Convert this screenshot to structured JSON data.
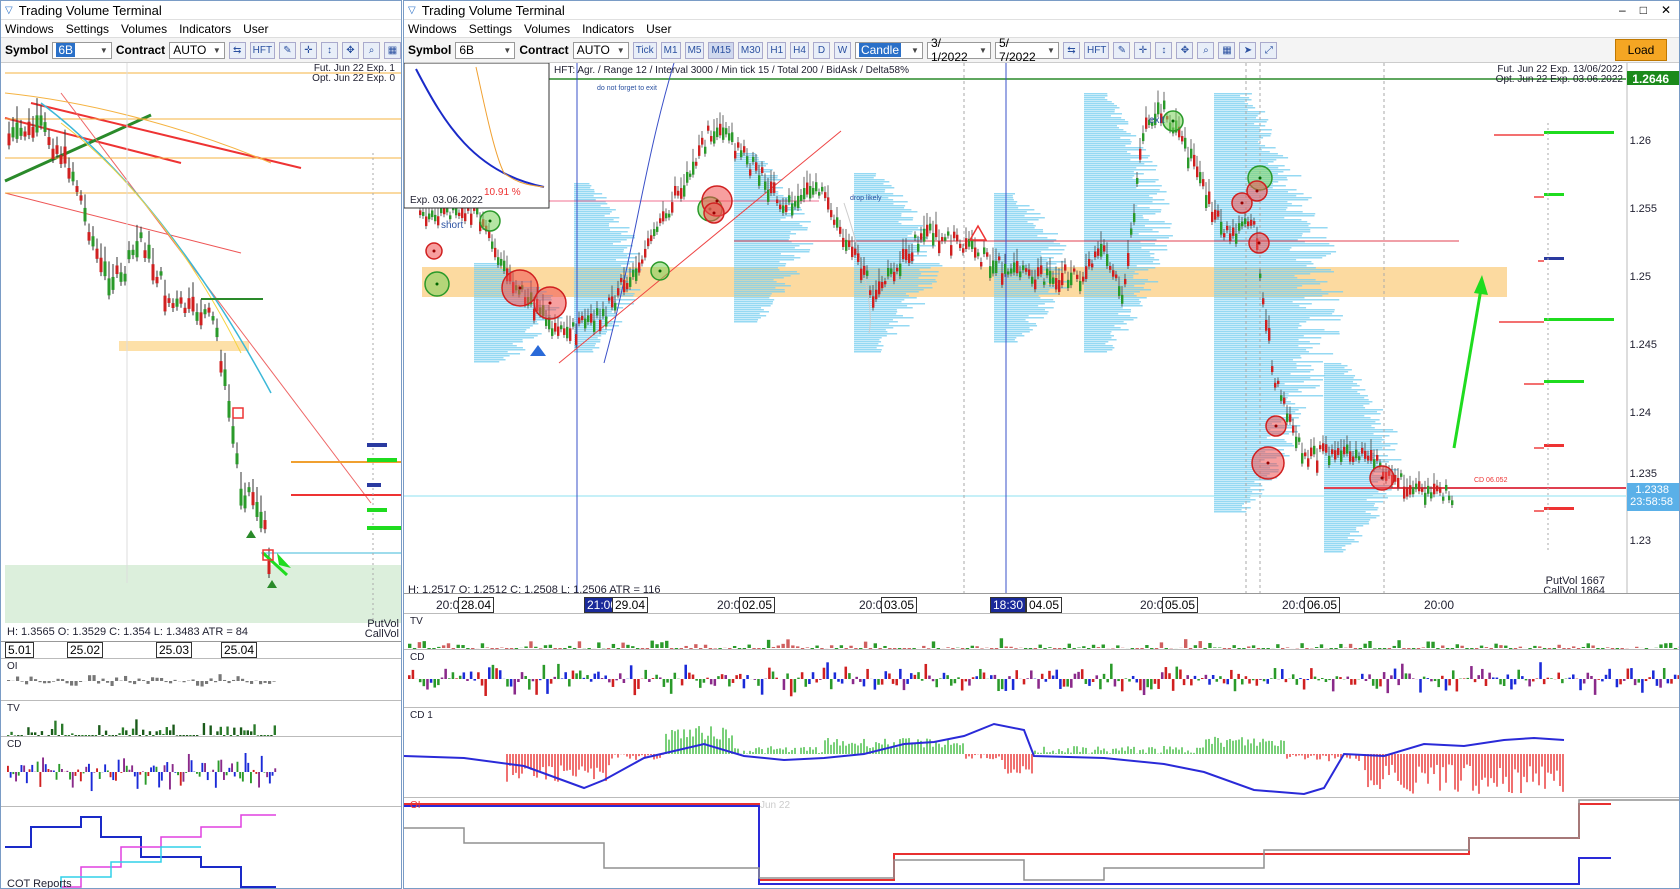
{
  "left": {
    "title": "Trading Volume Terminal",
    "menu": [
      "Windows",
      "Settings",
      "Volumes",
      "Indicators",
      "User"
    ],
    "symbol_label": "Symbol",
    "symbol": "6B",
    "contract_label": "Contract",
    "contract": "AUTO",
    "hft": "HFT",
    "chart_overlay_1": "Fut. Jun 22 Exp. 1",
    "chart_overlay_2": "Opt. Jun 22 Exp. 0",
    "ohlc": "H: 1.3565   O: 1.3529   C: 1.354   L: 1.3483   ATR = 84",
    "putvol": "PutVol",
    "callvol": "CallVol",
    "dates": [
      "5.01",
      "25.02",
      "25.03",
      "25.04"
    ],
    "panels": {
      "oi": "OI",
      "tv": "TV",
      "cd": "CD",
      "cot": "COT Reports"
    }
  },
  "right": {
    "title": "Trading Volume Terminal",
    "window_controls": [
      "–",
      "□",
      "✕"
    ],
    "menu": [
      "Windows",
      "Settings",
      "Volumes",
      "Indicators",
      "User"
    ],
    "symbol_label": "Symbol",
    "symbol": "6B",
    "contract_label": "Contract",
    "contract": "AUTO",
    "timeframes": [
      "Tick",
      "M1",
      "M5",
      "M15",
      "M30",
      "H1",
      "H4",
      "D",
      "W"
    ],
    "chart_type": "Candle",
    "date_from": "3/ 1/2022",
    "date_to": "5/ 7/2022",
    "hft": "HFT",
    "load": "Load",
    "info_line": "HFT: Agr. / Range 12 / Interval 3000 / Min tick 15 / Total 200 / BidAsk / Delta58%",
    "fut_line": "Fut. Jun 22 Exp. 13/06/2022",
    "opt_line": "Opt. Jun 22 Exp. 03.06.2022",
    "current_price": "1.2646",
    "last_price": "1.2338",
    "countdown": "23:58:58",
    "price_ticks": [
      "1.26",
      "1.255",
      "1.25",
      "1.245",
      "1.24",
      "1.235",
      "1.23"
    ],
    "ohlc": "H: 1.2517   O: 1.2512   C: 1.2508   L: 1.2506   ATR = 116",
    "putvol": "PutVol  1667",
    "callvol": "CallVol  1864",
    "inset_pct": "10.91 %",
    "exp_label": "Exp. 03.06.2022",
    "annotations": {
      "short": "short",
      "exit": "exit",
      "do_not_forget": "do not forget to exit",
      "drop": "drop likely",
      "cd": "CD 06.052"
    },
    "time_axis": [
      {
        "label": "20:00",
        "box": "28.04"
      },
      {
        "label": "21:00",
        "box": "29.04"
      },
      {
        "label": "20:00",
        "box": "02.05"
      },
      {
        "label": "20:00",
        "box": "03.05"
      },
      {
        "label": "18:30",
        "box": "04.05"
      },
      {
        "label": "20:00",
        "box": "05.05"
      },
      {
        "label": "20:00",
        "box": "06.05"
      },
      {
        "label": "20:00",
        "box": ""
      }
    ],
    "panels": {
      "tv": "TV",
      "cd": "CD",
      "cd1": "CD 1",
      "oi": "OI",
      "jun": "Jun 22"
    }
  }
}
